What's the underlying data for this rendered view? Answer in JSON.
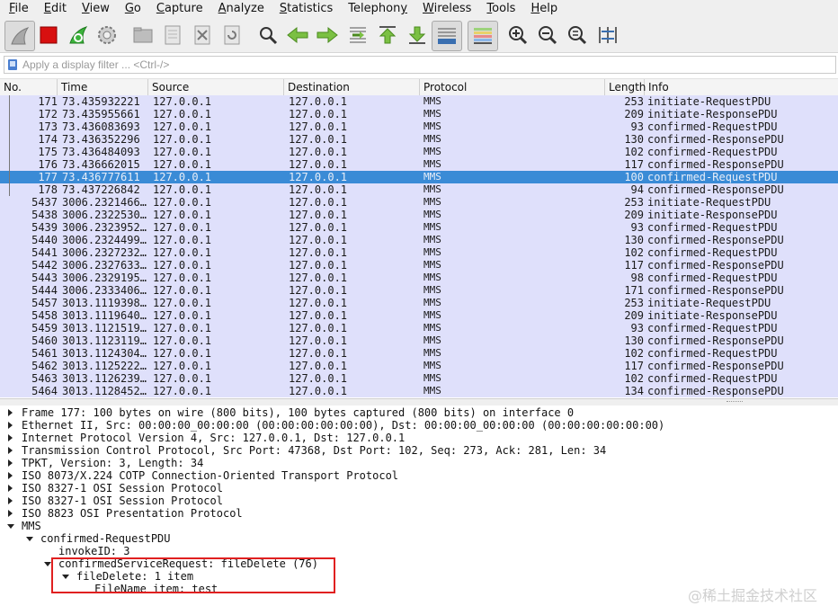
{
  "menu": [
    {
      "label": "File",
      "ul": "F",
      "rest": "ile"
    },
    {
      "label": "Edit",
      "ul": "E",
      "rest": "dit"
    },
    {
      "label": "View",
      "ul": "V",
      "rest": "iew"
    },
    {
      "label": "Go",
      "ul": "G",
      "rest": "o"
    },
    {
      "label": "Capture",
      "ul": "C",
      "rest": "apture"
    },
    {
      "label": "Analyze",
      "ul": "A",
      "rest": "nalyze"
    },
    {
      "label": "Statistics",
      "ul": "S",
      "rest": "tatistics"
    },
    {
      "label": "Telephony",
      "ul": "y",
      "pre": "Telephon",
      "rest": ""
    },
    {
      "label": "Wireless",
      "ul": "W",
      "rest": "ireless"
    },
    {
      "label": "Tools",
      "ul": "T",
      "rest": "ools"
    },
    {
      "label": "Help",
      "ul": "H",
      "rest": "elp"
    }
  ],
  "toolbar": {
    "icons": [
      "shark-fin-start-icon",
      "stop-capture-icon",
      "restart-capture-icon",
      "capture-options-icon",
      "open-file-icon",
      "save-file-icon",
      "close-file-icon",
      "reload-file-icon",
      "find-packet-icon",
      "go-back-icon",
      "go-forward-icon",
      "go-to-packet-icon",
      "go-first-icon",
      "go-last-icon",
      "autoscroll-icon",
      "colorize-icon",
      "zoom-in-icon",
      "zoom-out-icon",
      "zoom-normal-icon",
      "resize-columns-icon"
    ]
  },
  "filter": {
    "placeholder": "Apply a display filter ... <Ctrl-/>",
    "value": ""
  },
  "packet_list": {
    "columns": [
      "No.",
      "Time",
      "Source",
      "Destination",
      "Protocol",
      "Length",
      "Info"
    ],
    "selected_no": "177",
    "rows": [
      {
        "no": "171",
        "time": "73.435932221",
        "src": "127.0.0.1",
        "dst": "127.0.0.1",
        "proto": "MMS",
        "len": "253",
        "info": "initiate-RequestPDU"
      },
      {
        "no": "172",
        "time": "73.435955661",
        "src": "127.0.0.1",
        "dst": "127.0.0.1",
        "proto": "MMS",
        "len": "209",
        "info": "initiate-ResponsePDU"
      },
      {
        "no": "173",
        "time": "73.436083693",
        "src": "127.0.0.1",
        "dst": "127.0.0.1",
        "proto": "MMS",
        "len": "93",
        "info": "confirmed-RequestPDU"
      },
      {
        "no": "174",
        "time": "73.436352296",
        "src": "127.0.0.1",
        "dst": "127.0.0.1",
        "proto": "MMS",
        "len": "130",
        "info": "confirmed-ResponsePDU"
      },
      {
        "no": "175",
        "time": "73.436484093",
        "src": "127.0.0.1",
        "dst": "127.0.0.1",
        "proto": "MMS",
        "len": "102",
        "info": "confirmed-RequestPDU"
      },
      {
        "no": "176",
        "time": "73.436662015",
        "src": "127.0.0.1",
        "dst": "127.0.0.1",
        "proto": "MMS",
        "len": "117",
        "info": "confirmed-ResponsePDU"
      },
      {
        "no": "177",
        "time": "73.436777611",
        "src": "127.0.0.1",
        "dst": "127.0.0.1",
        "proto": "MMS",
        "len": "100",
        "info": "confirmed-RequestPDU"
      },
      {
        "no": "178",
        "time": "73.437226842",
        "src": "127.0.0.1",
        "dst": "127.0.0.1",
        "proto": "MMS",
        "len": "94",
        "info": "confirmed-ResponsePDU"
      },
      {
        "no": "5437",
        "time": "3006.2321466…",
        "src": "127.0.0.1",
        "dst": "127.0.0.1",
        "proto": "MMS",
        "len": "253",
        "info": "initiate-RequestPDU"
      },
      {
        "no": "5438",
        "time": "3006.2322530…",
        "src": "127.0.0.1",
        "dst": "127.0.0.1",
        "proto": "MMS",
        "len": "209",
        "info": "initiate-ResponsePDU"
      },
      {
        "no": "5439",
        "time": "3006.2323952…",
        "src": "127.0.0.1",
        "dst": "127.0.0.1",
        "proto": "MMS",
        "len": "93",
        "info": "confirmed-RequestPDU"
      },
      {
        "no": "5440",
        "time": "3006.2324499…",
        "src": "127.0.0.1",
        "dst": "127.0.0.1",
        "proto": "MMS",
        "len": "130",
        "info": "confirmed-ResponsePDU"
      },
      {
        "no": "5441",
        "time": "3006.2327232…",
        "src": "127.0.0.1",
        "dst": "127.0.0.1",
        "proto": "MMS",
        "len": "102",
        "info": "confirmed-RequestPDU"
      },
      {
        "no": "5442",
        "time": "3006.2327633…",
        "src": "127.0.0.1",
        "dst": "127.0.0.1",
        "proto": "MMS",
        "len": "117",
        "info": "confirmed-ResponsePDU"
      },
      {
        "no": "5443",
        "time": "3006.2329195…",
        "src": "127.0.0.1",
        "dst": "127.0.0.1",
        "proto": "MMS",
        "len": "98",
        "info": "confirmed-RequestPDU"
      },
      {
        "no": "5444",
        "time": "3006.2333406…",
        "src": "127.0.0.1",
        "dst": "127.0.0.1",
        "proto": "MMS",
        "len": "171",
        "info": "confirmed-ResponsePDU"
      },
      {
        "no": "5457",
        "time": "3013.1119398…",
        "src": "127.0.0.1",
        "dst": "127.0.0.1",
        "proto": "MMS",
        "len": "253",
        "info": "initiate-RequestPDU"
      },
      {
        "no": "5458",
        "time": "3013.1119640…",
        "src": "127.0.0.1",
        "dst": "127.0.0.1",
        "proto": "MMS",
        "len": "209",
        "info": "initiate-ResponsePDU"
      },
      {
        "no": "5459",
        "time": "3013.1121519…",
        "src": "127.0.0.1",
        "dst": "127.0.0.1",
        "proto": "MMS",
        "len": "93",
        "info": "confirmed-RequestPDU"
      },
      {
        "no": "5460",
        "time": "3013.1123119…",
        "src": "127.0.0.1",
        "dst": "127.0.0.1",
        "proto": "MMS",
        "len": "130",
        "info": "confirmed-ResponsePDU"
      },
      {
        "no": "5461",
        "time": "3013.1124304…",
        "src": "127.0.0.1",
        "dst": "127.0.0.1",
        "proto": "MMS",
        "len": "102",
        "info": "confirmed-RequestPDU"
      },
      {
        "no": "5462",
        "time": "3013.1125222…",
        "src": "127.0.0.1",
        "dst": "127.0.0.1",
        "proto": "MMS",
        "len": "117",
        "info": "confirmed-ResponsePDU"
      },
      {
        "no": "5463",
        "time": "3013.1126239…",
        "src": "127.0.0.1",
        "dst": "127.0.0.1",
        "proto": "MMS",
        "len": "102",
        "info": "confirmed-RequestPDU"
      },
      {
        "no": "5464",
        "time": "3013.1128452…",
        "src": "127.0.0.1",
        "dst": "127.0.0.1",
        "proto": "MMS",
        "len": "134",
        "info": "confirmed-ResponsePDU"
      }
    ]
  },
  "details": [
    {
      "text": "Frame 177: 100 bytes on wire (800 bits), 100 bytes captured (800 bits) on interface 0",
      "level": 0,
      "state": "collapsed"
    },
    {
      "text": "Ethernet II, Src: 00:00:00_00:00:00 (00:00:00:00:00:00), Dst: 00:00:00_00:00:00 (00:00:00:00:00:00)",
      "level": 0,
      "state": "collapsed"
    },
    {
      "text": "Internet Protocol Version 4, Src: 127.0.0.1, Dst: 127.0.0.1",
      "level": 0,
      "state": "collapsed"
    },
    {
      "text": "Transmission Control Protocol, Src Port: 47368, Dst Port: 102, Seq: 273, Ack: 281, Len: 34",
      "level": 0,
      "state": "collapsed"
    },
    {
      "text": "TPKT, Version: 3, Length: 34",
      "level": 0,
      "state": "collapsed"
    },
    {
      "text": "ISO 8073/X.224 COTP Connection-Oriented Transport Protocol",
      "level": 0,
      "state": "collapsed"
    },
    {
      "text": "ISO 8327-1 OSI Session Protocol",
      "level": 0,
      "state": "collapsed"
    },
    {
      "text": "ISO 8327-1 OSI Session Protocol",
      "level": 0,
      "state": "collapsed"
    },
    {
      "text": "ISO 8823 OSI Presentation Protocol",
      "level": 0,
      "state": "collapsed"
    },
    {
      "text": "MMS",
      "level": 0,
      "state": "expanded"
    },
    {
      "text": "confirmed-RequestPDU",
      "level": 1,
      "state": "expanded"
    },
    {
      "text": "invokeID: 3",
      "level": 2,
      "state": "leaf"
    },
    {
      "text": "confirmedServiceRequest: fileDelete (76)",
      "level": 2,
      "state": "expanded"
    },
    {
      "text": "fileDelete: 1 item",
      "level": 3,
      "state": "expanded"
    },
    {
      "text": "FileName item: test",
      "level": 4,
      "state": "leaf"
    }
  ],
  "watermark": "@稀土掘金技术社区",
  "colors": {
    "row_bg": "#dfe0fb",
    "selected_row_bg": "#3a8bd6",
    "highlight_box": "#e02020"
  }
}
